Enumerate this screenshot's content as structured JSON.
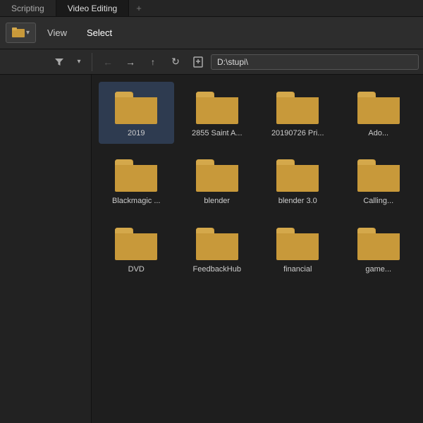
{
  "tabs": [
    {
      "id": "scripting",
      "label": "Scripting",
      "active": false
    },
    {
      "id": "video-editing",
      "label": "Video Editing",
      "active": true
    }
  ],
  "tab_add_label": "+",
  "menu": {
    "folder_icon": "📁",
    "items": [
      {
        "id": "view",
        "label": "View"
      },
      {
        "id": "select",
        "label": "Select"
      }
    ]
  },
  "toolbar": {
    "filter_icon": "▼",
    "back_icon": "←",
    "forward_icon": "→",
    "up_icon": "↑",
    "refresh_icon": "↻",
    "bookmark_icon": "📌",
    "address": "D:\\stupi\\"
  },
  "files": [
    {
      "id": "2019",
      "label": "2019",
      "selected": true
    },
    {
      "id": "2855-saint",
      "label": "2855 Saint A..."
    },
    {
      "id": "20190726",
      "label": "20190726 Pri..."
    },
    {
      "id": "ado",
      "label": "Ado..."
    },
    {
      "id": "blackmagic",
      "label": "Blackmagic ..."
    },
    {
      "id": "blender",
      "label": "blender"
    },
    {
      "id": "blender-30",
      "label": "blender 3.0"
    },
    {
      "id": "calling",
      "label": "Calling..."
    },
    {
      "id": "dvd",
      "label": "DVD"
    },
    {
      "id": "feedbackhub",
      "label": "FeedbackHub"
    },
    {
      "id": "financial",
      "label": "financial"
    },
    {
      "id": "game",
      "label": "game..."
    }
  ]
}
